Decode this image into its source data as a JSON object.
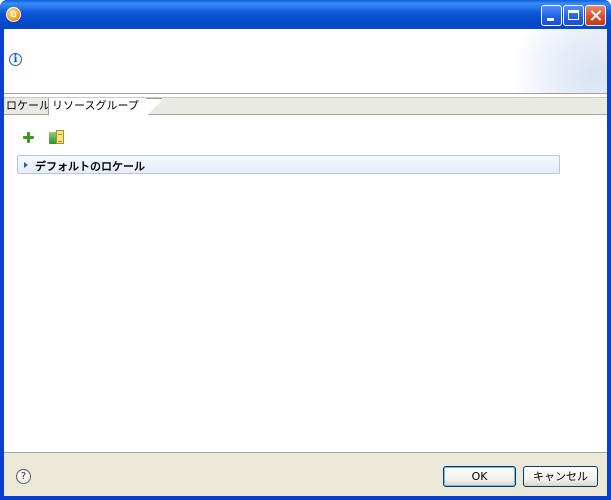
{
  "window": {
    "title": "",
    "icon": "app-icon"
  },
  "header": {
    "info_icon_glyph": "i"
  },
  "tabs": [
    {
      "label": "ロケール",
      "selected": false
    },
    {
      "label": "リソースグループ",
      "selected": true
    }
  ],
  "toolbar": {
    "add_icon": "plus-icon",
    "bundle_icon": "resource-bundle-icon"
  },
  "section": {
    "title": "デフォルトのロケール",
    "expanded": false
  },
  "footer": {
    "help_glyph": "?",
    "ok_label": "OK",
    "cancel_label": "キャンセル"
  },
  "colors": {
    "titlebar": "#0b56d8",
    "section_border": "#b5c7e3",
    "footer_bg": "#ece9d8",
    "plus_green": "#3a9a22"
  }
}
